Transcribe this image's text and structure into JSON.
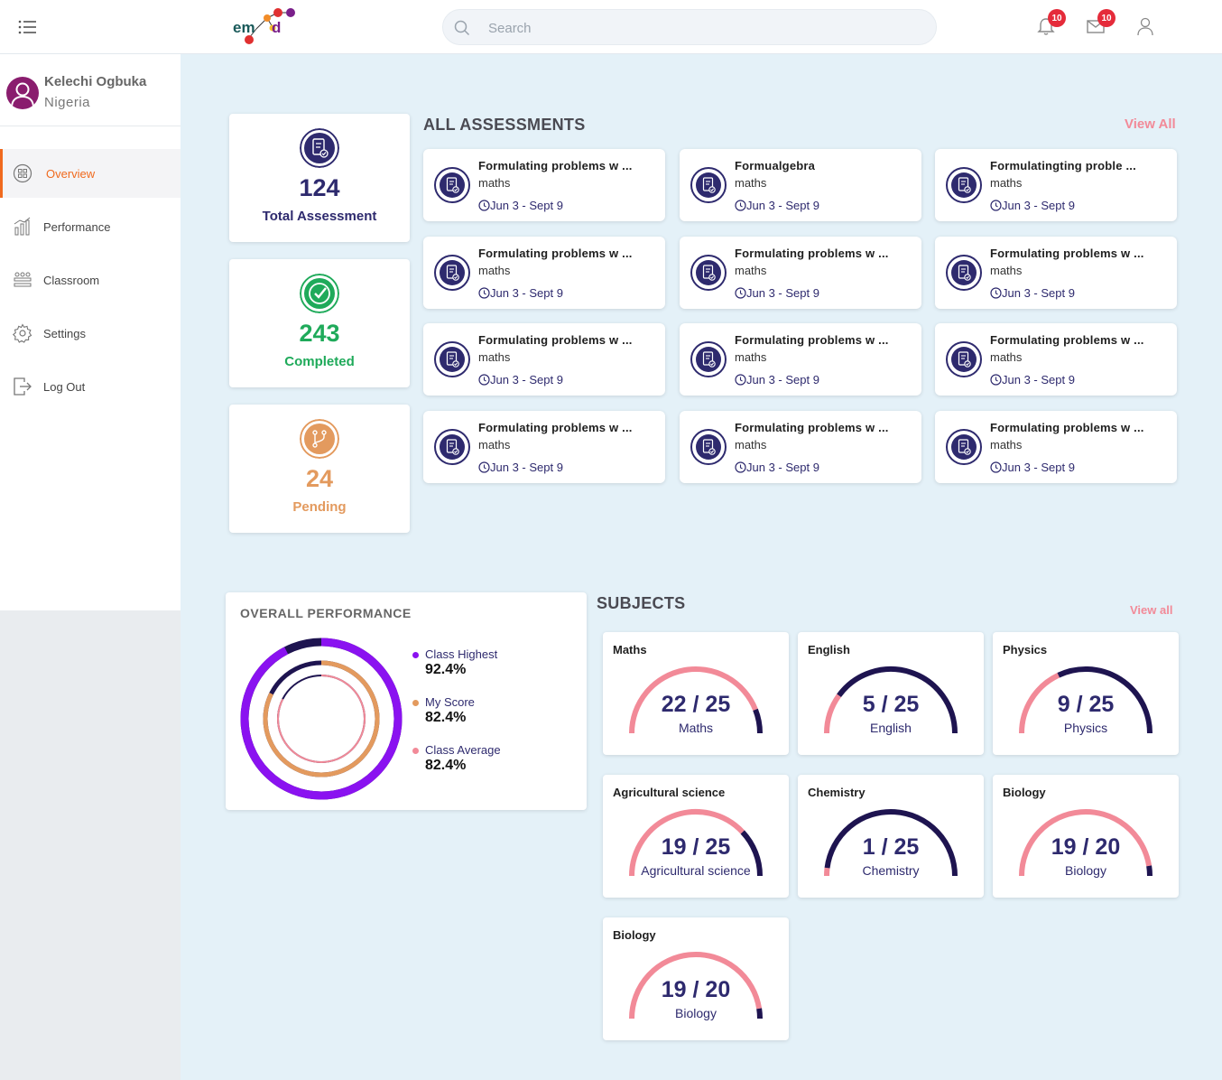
{
  "header": {
    "search_placeholder": "Search",
    "notifications_count": "10",
    "messages_count": "10"
  },
  "profile": {
    "name": "Kelechi Ogbuka",
    "country": "Nigeria"
  },
  "sidebar": {
    "items": [
      {
        "label": "Overview",
        "icon": "grid-icon",
        "active": true
      },
      {
        "label": "Performance",
        "icon": "chart-icon"
      },
      {
        "label": "Classroom",
        "icon": "classroom-icon"
      },
      {
        "label": "Settings",
        "icon": "gear-icon"
      },
      {
        "label": "Log Out",
        "icon": "logout-icon"
      }
    ]
  },
  "stats": [
    {
      "value": "124",
      "label": "Total Assessment",
      "color": "#2e2a6e"
    },
    {
      "value": "243",
      "label": "Completed",
      "color": "#1faa5a"
    },
    {
      "value": "24",
      "label": "Pending",
      "color": "#e39a5e"
    }
  ],
  "assessments": {
    "title": "ALL ASSESSMENTS",
    "view_all": "View All",
    "items": [
      {
        "title": "Formulating problems w ...",
        "subject": "maths",
        "date": "Jun 3 - Sept 9"
      },
      {
        "title": "Formualgebra",
        "subject": "maths",
        "date": "Jun 3 - Sept 9"
      },
      {
        "title": "Formulatingting proble ...",
        "subject": "maths",
        "date": "Jun 3 - Sept 9"
      },
      {
        "title": "Formulating problems w ...",
        "subject": "maths",
        "date": "Jun 3 - Sept 9"
      },
      {
        "title": "Formulating problems w ...",
        "subject": "maths",
        "date": "Jun 3 - Sept 9"
      },
      {
        "title": "Formulating problems w ...",
        "subject": "maths",
        "date": "Jun 3 - Sept 9"
      },
      {
        "title": "Formulating problems w ...",
        "subject": "maths",
        "date": "Jun 3 - Sept 9"
      },
      {
        "title": "Formulating problems w ...",
        "subject": "maths",
        "date": "Jun 3 - Sept 9"
      },
      {
        "title": "Formulating problems w ...",
        "subject": "maths",
        "date": "Jun 3 - Sept 9"
      },
      {
        "title": "Formulating problems w ...",
        "subject": "maths",
        "date": "Jun 3 - Sept 9"
      },
      {
        "title": "Formulating problems w ...",
        "subject": "maths",
        "date": "Jun 3 - Sept 9"
      },
      {
        "title": "Formulating problems w ...",
        "subject": "maths",
        "date": "Jun 3 - Sept 9"
      }
    ]
  },
  "performance": {
    "title": "OVERALL PERFORMANCE",
    "series": [
      {
        "name": "Class Highest",
        "value": "92.4%",
        "fraction": 0.924,
        "color": "#8a12f0"
      },
      {
        "name": "My Score",
        "value": "82.4%",
        "fraction": 0.824,
        "color": "#e39a5e"
      },
      {
        "name": "Class Average",
        "value": "82.4%",
        "fraction": 0.824,
        "color": "#f28a98"
      }
    ],
    "track_color": "#1e1450"
  },
  "subjects": {
    "title": "SUBJECTS",
    "view_all": "View all",
    "items": [
      {
        "title": "Maths",
        "score": "22 / 25",
        "name": "Maths",
        "fraction": 0.88
      },
      {
        "title": "English",
        "score": "5 / 25",
        "name": "English",
        "fraction": 0.2
      },
      {
        "title": "Physics",
        "score": "9 / 25",
        "name": "Physics",
        "fraction": 0.36
      },
      {
        "title": "Agricultural science",
        "score": "19 / 25",
        "name": "Agricultural science",
        "fraction": 0.76
      },
      {
        "title": "Chemistry",
        "score": "1 / 25",
        "name": "Chemistry",
        "fraction": 0.04
      },
      {
        "title": "Biology",
        "score": "19 / 20",
        "name": "Biology",
        "fraction": 0.95
      },
      {
        "title": "Biology",
        "score": "19 / 20",
        "name": "Biology",
        "fraction": 0.95
      }
    ],
    "filled_color": "#f28a98",
    "empty_color": "#1e1450"
  }
}
